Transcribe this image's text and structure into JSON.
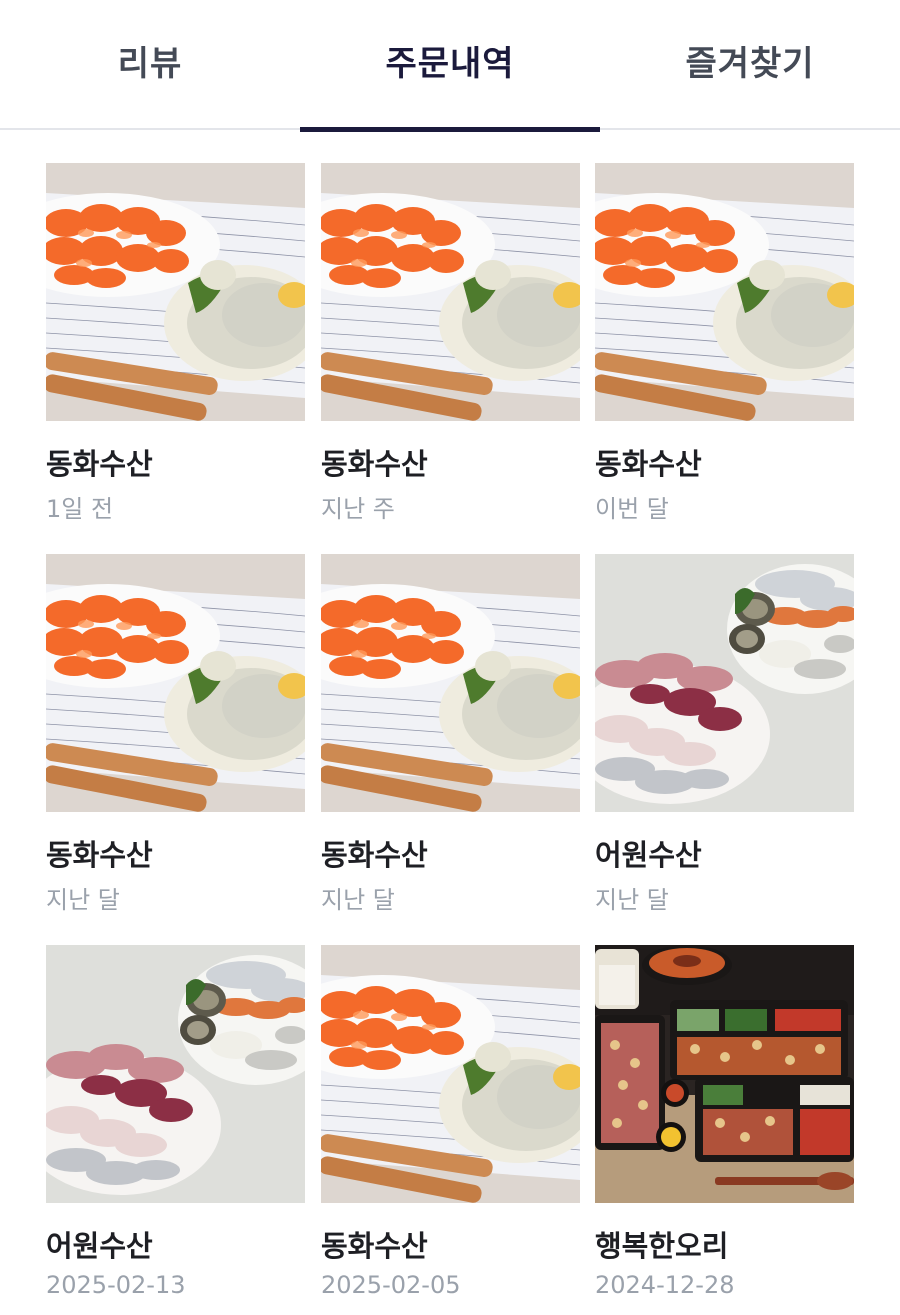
{
  "tabs": [
    {
      "label": "리뷰",
      "active": false
    },
    {
      "label": "주문내역",
      "active": true
    },
    {
      "label": "즐겨찾기",
      "active": false
    }
  ],
  "orders": [
    {
      "store": "동화수산",
      "date": "1일 전",
      "image": "salmon-flatfish-platter-image"
    },
    {
      "store": "동화수산",
      "date": "지난 주",
      "image": "salmon-flatfish-platter-image"
    },
    {
      "store": "동화수산",
      "date": "이번 달",
      "image": "salmon-flatfish-platter-image"
    },
    {
      "store": "동화수산",
      "date": "지난 달",
      "image": "salmon-flatfish-platter-image"
    },
    {
      "store": "동화수산",
      "date": "지난 달",
      "image": "salmon-flatfish-platter-image"
    },
    {
      "store": "어원수산",
      "date": "지난 달",
      "image": "assorted-sashimi-abalone-image"
    },
    {
      "store": "어원수산",
      "date": "2025-02-13",
      "image": "assorted-sashimi-abalone-image"
    },
    {
      "store": "동화수산",
      "date": "2025-02-05",
      "image": "salmon-flatfish-platter-image"
    },
    {
      "store": "행복한오리",
      "date": "2024-12-28",
      "image": "duck-meal-set-image"
    }
  ],
  "colors": {
    "active_tab": "#1b1a3c",
    "inactive_tab": "#444a56",
    "store_name": "#1e1f24",
    "date_text": "#9aa1ab",
    "divider": "#e3e5ea"
  }
}
